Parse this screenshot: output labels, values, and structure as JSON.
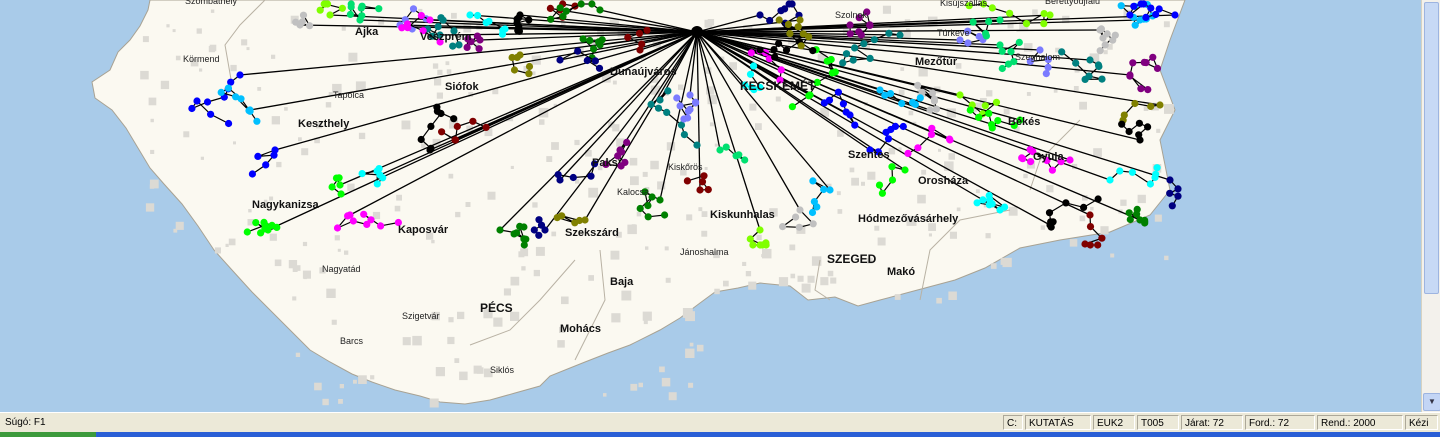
{
  "map": {
    "colors": {
      "sea": "#a9cbe9",
      "land": "#fbf9f1",
      "border": "#b9b2a4",
      "hub_lines": "#000000"
    },
    "cities": [
      {
        "name": "Szombathely",
        "size": "small"
      },
      {
        "name": "Ajka",
        "size": "mid"
      },
      {
        "name": "Veszprém",
        "size": "mid"
      },
      {
        "name": "Körmend",
        "size": "small"
      },
      {
        "name": "Tapolca",
        "size": "small"
      },
      {
        "name": "Siófok",
        "size": "mid"
      },
      {
        "name": "Dunaújváros",
        "size": "mid"
      },
      {
        "name": "KECSKEMÉT",
        "size": "big"
      },
      {
        "name": "Szolnok",
        "size": "small"
      },
      {
        "name": "Kisújszállás",
        "size": "small"
      },
      {
        "name": "Berettyóújfalu",
        "size": "small"
      },
      {
        "name": "Túrkeve",
        "size": "small"
      },
      {
        "name": "Mezőtúr",
        "size": "mid"
      },
      {
        "name": "Szeghalom",
        "size": "small"
      },
      {
        "name": "Keszthely",
        "size": "mid"
      },
      {
        "name": "Békés",
        "size": "mid"
      },
      {
        "name": "Paks",
        "size": "mid"
      },
      {
        "name": "Kiskőrös",
        "size": "small"
      },
      {
        "name": "Szentes",
        "size": "mid"
      },
      {
        "name": "Gyula",
        "size": "mid"
      },
      {
        "name": "Kalocsa",
        "size": "small"
      },
      {
        "name": "Orosháza",
        "size": "mid"
      },
      {
        "name": "Nagykanizsa",
        "size": "mid"
      },
      {
        "name": "Kiskunhalas",
        "size": "mid"
      },
      {
        "name": "Hódmezővásárhely",
        "size": "mid"
      },
      {
        "name": "Kaposvár",
        "size": "mid"
      },
      {
        "name": "Szekszárd",
        "size": "mid"
      },
      {
        "name": "Jánoshalma",
        "size": "small"
      },
      {
        "name": "SZEGED",
        "size": "big"
      },
      {
        "name": "Makó",
        "size": "mid"
      },
      {
        "name": "Nagyatád",
        "size": "small"
      },
      {
        "name": "Baja",
        "size": "mid"
      },
      {
        "name": "PÉCS",
        "size": "big"
      },
      {
        "name": "Szigetvár",
        "size": "small"
      },
      {
        "name": "Mohács",
        "size": "mid"
      },
      {
        "name": "Barcs",
        "size": "small"
      },
      {
        "name": "Siklós",
        "size": "small"
      }
    ],
    "routes": [
      {
        "color": "#0000ff"
      },
      {
        "color": "#00ff00"
      },
      {
        "color": "#ff00ff"
      },
      {
        "color": "#00ffff"
      },
      {
        "color": "#000000"
      },
      {
        "color": "#800000"
      },
      {
        "color": "#008000"
      },
      {
        "color": "#000080"
      },
      {
        "color": "#808000"
      },
      {
        "color": "#800080"
      },
      {
        "color": "#008080"
      },
      {
        "color": "#7b7bff"
      },
      {
        "color": "#00e070"
      },
      {
        "color": "#80ff00"
      },
      {
        "color": "#c0c0c0"
      },
      {
        "color": "#00c0ff"
      }
    ]
  },
  "status": {
    "help": "Súgó: F1",
    "c_label": "C:",
    "mode": "KUTATÁS",
    "euk": "EUK2",
    "code": "T005",
    "jarat": "Járat:  72",
    "ford": "Ford.:  72",
    "rend": "Rend.: 2000",
    "kezi": "Kézi"
  }
}
